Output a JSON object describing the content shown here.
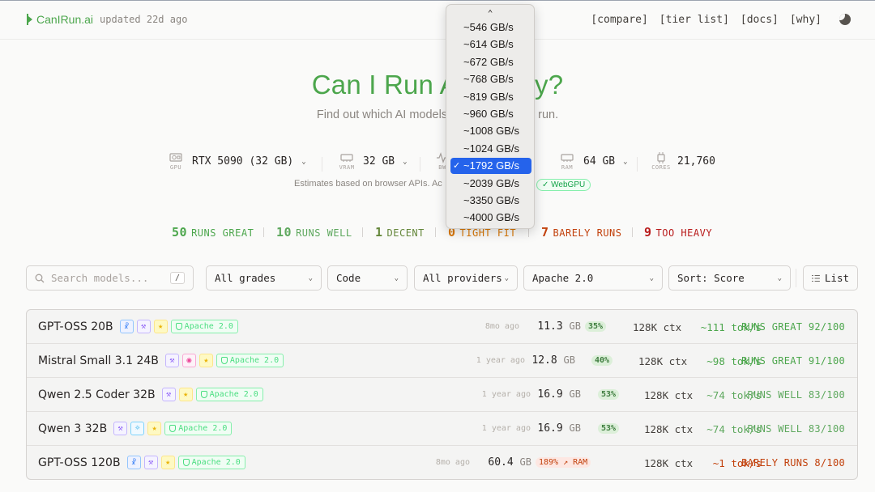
{
  "brand": {
    "name": "CanIRun.ai",
    "updated": "updated 22d ago"
  },
  "nav": {
    "compare": "[compare]",
    "tier_list": "[tier list]",
    "docs": "[docs]",
    "why": "[why]"
  },
  "hero": {
    "title": "Can I Run AI locally?",
    "subtitle": "Find out which AI models you can actually run."
  },
  "specs": {
    "gpu": {
      "caption": "GPU",
      "value": "RTX 5090 (32 GB)"
    },
    "vram": {
      "caption": "VRAM",
      "value": "32 GB"
    },
    "bw": {
      "caption": "BW"
    },
    "ram": {
      "caption": "RAM",
      "value": "64 GB"
    },
    "cores": {
      "caption": "CORES",
      "value": "21,760"
    },
    "note": "Estimates based on browser APIs. Ac",
    "webgpu": "WebGPU"
  },
  "counts": [
    {
      "n": "50",
      "label": "RUNS GREAT",
      "color": "#4ca64c"
    },
    {
      "n": "10",
      "label": "RUNS WELL",
      "color": "#5ea85e"
    },
    {
      "n": "1",
      "label": "DECENT",
      "color": "#65873b"
    },
    {
      "n": "0",
      "label": "TIGHT FIT",
      "color": "#d97706"
    },
    {
      "n": "7",
      "label": "BARELY RUNS",
      "color": "#c2410c"
    },
    {
      "n": "9",
      "label": "TOO HEAVY",
      "color": "#b91c1c"
    }
  ],
  "filters": {
    "search_placeholder": "Search models...",
    "search_shortcut": "/",
    "grades": "All grades",
    "task": "Code",
    "providers": "All providers",
    "license": "Apache 2.0",
    "sort": "Sort: Score",
    "view": "List"
  },
  "bandwidth_dropdown": {
    "options": [
      "~546 GB/s",
      "~614 GB/s",
      "~672 GB/s",
      "~768 GB/s",
      "~819 GB/s",
      "~960 GB/s",
      "~1008 GB/s",
      "~1024 GB/s",
      "~1792 GB/s",
      "~2039 GB/s",
      "~3350 GB/s",
      "~4000 GB/s"
    ],
    "selected": "~1792 GB/s"
  },
  "models": [
    {
      "name": "GPT-OSS 20B",
      "badges": [
        "nodes-icon",
        "wrench-icon",
        "star-icon"
      ],
      "license": "Apache 2.0",
      "age": "8mo ago",
      "size": "11.3",
      "unit": "GB",
      "pct": "35%",
      "ctx": "128K ctx",
      "speed": "~111 tok/s",
      "grade": "RUNS GREAT 92/100",
      "grade_color": "#4ca64c"
    },
    {
      "name": "Mistral Small 3.1 24B",
      "badges": [
        "wrench-icon",
        "eye-icon",
        "star-icon"
      ],
      "license": "Apache 2.0",
      "age": "1 year ago",
      "size": "12.8",
      "unit": "GB",
      "pct": "40%",
      "ctx": "128K ctx",
      "speed": "~98 tok/s",
      "grade": "RUNS GREAT 91/100",
      "grade_color": "#4ca64c"
    },
    {
      "name": "Qwen 2.5 Coder 32B",
      "badges": [
        "wrench-icon",
        "star-icon"
      ],
      "license": "Apache 2.0",
      "age": "1 year ago",
      "size": "16.9",
      "unit": "GB",
      "pct": "53%",
      "ctx": "128K ctx",
      "speed": "~74 tok/s",
      "grade": "RUNS WELL 83/100",
      "grade_color": "#5ea85e"
    },
    {
      "name": "Qwen 3 32B",
      "badges": [
        "wrench-icon",
        "bulb-icon",
        "star-icon"
      ],
      "license": "Apache 2.0",
      "age": "1 year ago",
      "size": "16.9",
      "unit": "GB",
      "pct": "53%",
      "ctx": "128K ctx",
      "speed": "~74 tok/s",
      "grade": "RUNS WELL 83/100",
      "grade_color": "#5ea85e"
    },
    {
      "name": "GPT-OSS 120B",
      "badges": [
        "nodes-icon",
        "wrench-icon",
        "star-icon"
      ],
      "license": "Apache 2.0",
      "age": "8mo ago",
      "size": "60.4",
      "unit": "GB",
      "pct": "189% ↗ RAM",
      "ctx": "128K ctx",
      "speed": "~1 tok/s",
      "grade": "BARELY RUNS 8/100",
      "grade_color": "#c2410c"
    }
  ]
}
